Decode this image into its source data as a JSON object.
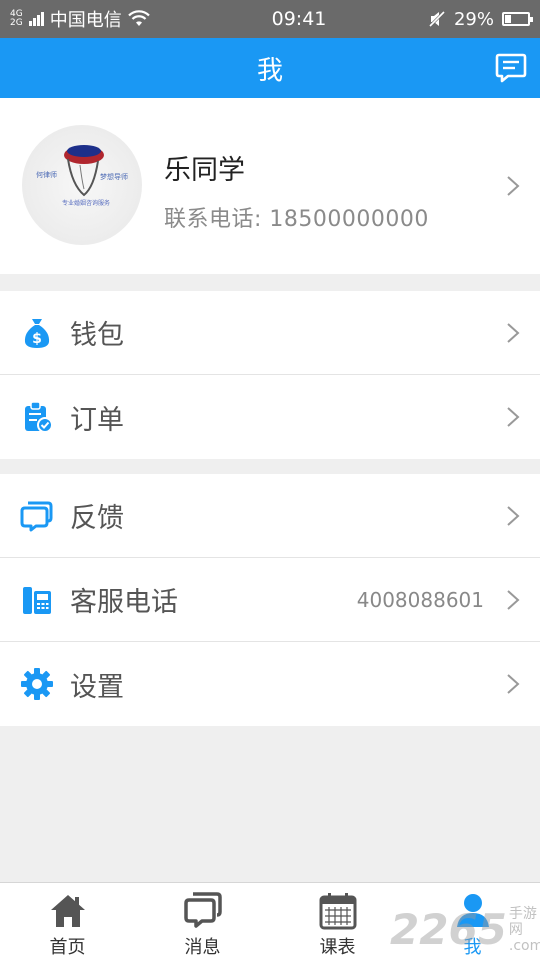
{
  "status_bar": {
    "network_top": "4G",
    "network_bottom": "2G",
    "carrier": "中国电信",
    "time": "09:41",
    "battery": "29%",
    "battery_level": 0.29
  },
  "header": {
    "title": "我"
  },
  "profile": {
    "name": "乐同学",
    "phone": "联系电话: 18500000000"
  },
  "menu_group_1": [
    {
      "label": "钱包",
      "icon": "money-bag-icon"
    },
    {
      "label": "订单",
      "icon": "order-clipboard-icon"
    }
  ],
  "menu_group_2": [
    {
      "label": "反馈",
      "icon": "feedback-icon",
      "value": ""
    },
    {
      "label": "客服电话",
      "icon": "phone-icon",
      "value": "4008088601"
    },
    {
      "label": "设置",
      "icon": "gear-icon",
      "value": ""
    }
  ],
  "tabs": [
    {
      "label": "首页",
      "icon": "home-icon",
      "active": false
    },
    {
      "label": "消息",
      "icon": "message-icon",
      "active": false
    },
    {
      "label": "课表",
      "icon": "calendar-icon",
      "active": false
    },
    {
      "label": "我",
      "icon": "person-icon",
      "active": true
    }
  ],
  "watermark": {
    "number": "2265",
    "line1": "手游网",
    "line2": ".com"
  },
  "colors": {
    "primary": "#1a98f4",
    "status_bar": "#6a6a6a",
    "background": "#efefef"
  }
}
